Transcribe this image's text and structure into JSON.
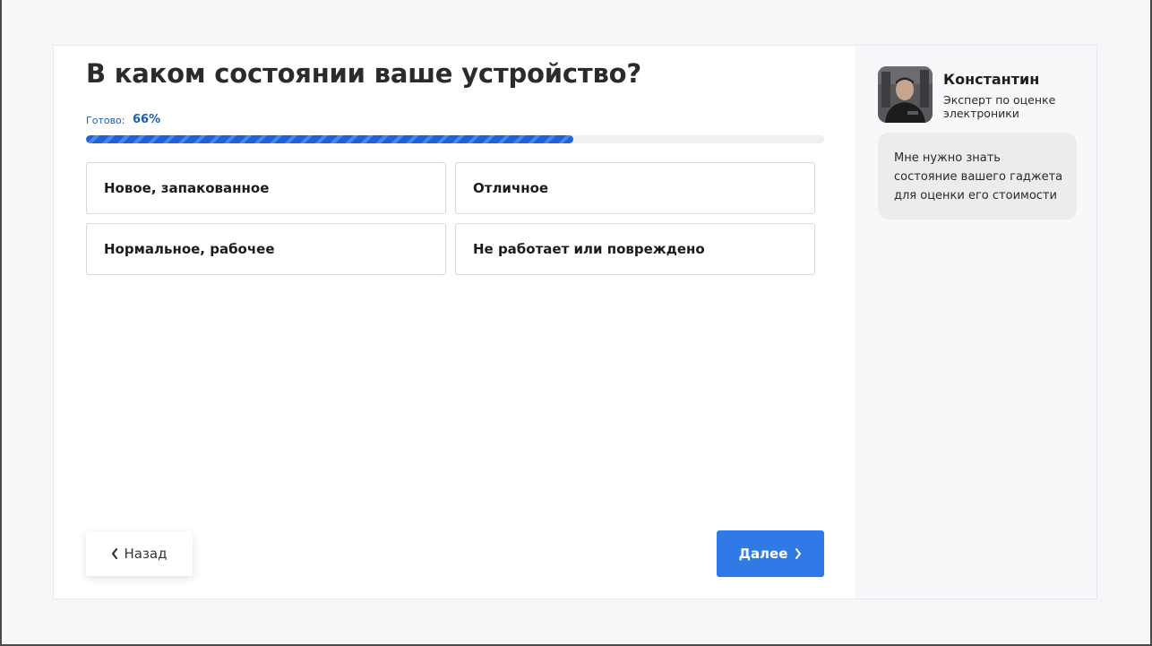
{
  "quiz": {
    "question": "В каком состоянии ваше устройство?",
    "progress_label": "Готово:",
    "progress_percent_text": "66%",
    "progress_fraction": 0.66,
    "options": [
      {
        "label": "Новое, запакованное"
      },
      {
        "label": "Отличное"
      },
      {
        "label": "Нормальное, рабочее"
      },
      {
        "label": "Не работает или повреждено"
      }
    ],
    "back_label": "Назад",
    "next_label": "Далее"
  },
  "expert": {
    "name": "Константин",
    "role": "Эксперт по оценке электроники",
    "message": "Мне нужно знать состояние вашего гаджета для оценки его стоимости"
  },
  "colors": {
    "accent": "#2f7ae6",
    "progress": "#1d63d8",
    "progress_text": "#1e5bb8"
  },
  "icons": {
    "back": "chevron-left-icon",
    "next": "chevron-right-icon"
  }
}
